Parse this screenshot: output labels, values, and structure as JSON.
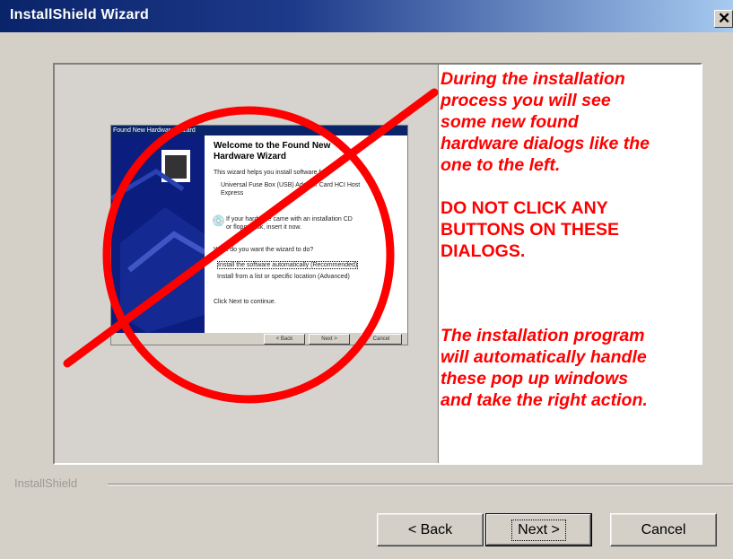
{
  "window": {
    "title": "InstallShield Wizard"
  },
  "mini_dialog": {
    "title": "Found New Hardware Wizard",
    "heading_line1": "Welcome to the Found New",
    "heading_line2": "Hardware Wizard",
    "body_line1": "This wizard helps you install software for:",
    "body_line2": "Universal Fuse Box (USB) Adapter Card HCI Host",
    "body_line3": "Express",
    "cd_line1": "If your hardware came with an installation CD",
    "cd_line2": "or floppy disk, insert it now.",
    "question": "What do you want the wizard to do?",
    "option_auto": "Install the software automatically (Recommended)",
    "option_list": "Install from a list or specific location (Advanced)",
    "continue": "Click Next to continue.",
    "back_label": "< Back",
    "next_label": "Next >",
    "cancel_label": "Cancel"
  },
  "message": {
    "line1": "During the installation",
    "line2": "process you will see",
    "line3": "some new found",
    "line4": "hardware dialogs like the",
    "line5": "one to the left.",
    "line6": "DO NOT CLICK ANY",
    "line7": "BUTTONS ON THESE",
    "line8": "DIALOGS.",
    "line9": "The installation program",
    "line10": "will automatically handle",
    "line11": "these pop up windows",
    "line12": "and take the right action."
  },
  "footer": {
    "brand": "InstallShield"
  },
  "buttons": {
    "back": "< Back",
    "next": "Next >",
    "cancel": "Cancel"
  },
  "colors": {
    "warning": "#ff0000",
    "titlebar": "#0a246a",
    "face": "#d4d0c8"
  }
}
